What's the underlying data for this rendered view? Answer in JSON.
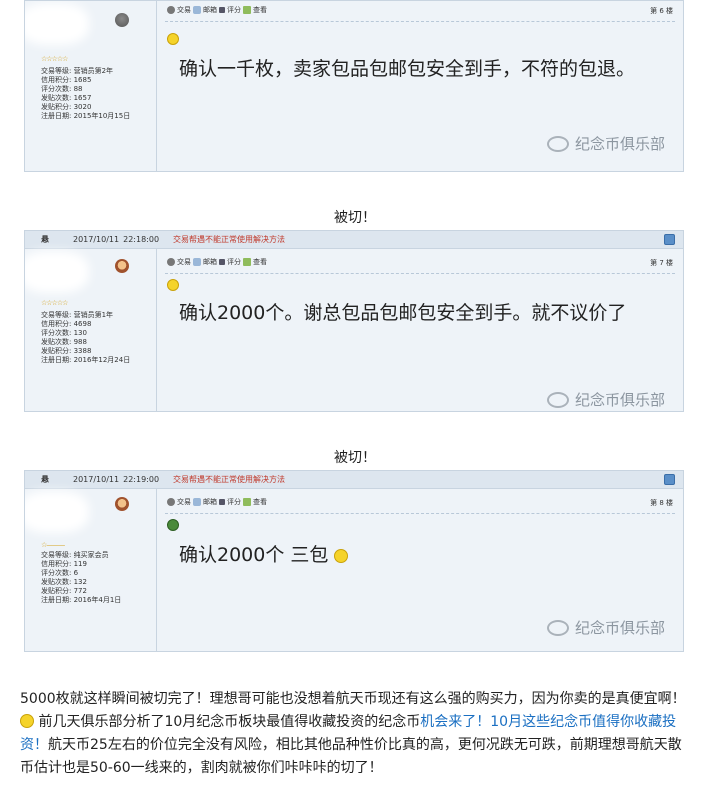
{
  "posts": [
    {
      "header": null,
      "user": {
        "stars": "☆☆☆☆☆",
        "info": [
          "交易等级: 营销员第2年",
          "信用积分: 1685",
          "评分次数: 88",
          "发贴次数: 1657",
          "发贴积分: 3020",
          "注册日期: 2015年10月15日"
        ]
      },
      "toolbar": {
        "trade": "交易",
        "mail": "邮箱",
        "rate": "评分",
        "view": "查看"
      },
      "floor": "第 6 楼",
      "text": "确认一千枚，卖家包品包邮包安全到手，不符的包退。",
      "watermark": "纪念币俱乐部"
    },
    {
      "header": {
        "author": "悬",
        "date": "2017/10/11",
        "time": "22:18:00",
        "notice": "交易帮遇不能正常使用解决方法"
      },
      "user": {
        "stars": "☆☆☆☆☆",
        "info": [
          "交易等级: 营销员第1年",
          "信用积分: 4698",
          "评分次数: 130",
          "发贴次数: 988",
          "发贴积分: 3388",
          "注册日期: 2016年12月24日"
        ]
      },
      "toolbar": {
        "trade": "交易",
        "mail": "邮箱",
        "rate": "评分",
        "view": "查看"
      },
      "floor": "第 7 楼",
      "text": "确认2000个。谢总包品包邮包安全到手。就不议价了",
      "watermark": "纪念币俱乐部"
    },
    {
      "header": {
        "author": "悬",
        "date": "2017/10/11",
        "time": "22:19:00",
        "notice": "交易帮遇不能正常使用解决方法"
      },
      "user": {
        "stars": "☆———",
        "info": [
          "交易等级: 纯买家会员",
          "信用积分: 119",
          "评分次数: 6",
          "发贴次数: 132",
          "发贴积分: 772",
          "注册日期: 2016年4月1日"
        ]
      },
      "toolbar": {
        "trade": "交易",
        "mail": "邮箱",
        "rate": "评分",
        "view": "查看"
      },
      "floor": "第 8 楼",
      "text": "确认2000个  三包",
      "watermark": "纪念币俱乐部"
    }
  ],
  "cut_labels": [
    "被切！",
    "被切！"
  ],
  "paragraph": {
    "part1": "5000枚就这样瞬间被切完了！理想哥可能也没想着航天币现还有这么强的购买力，因为你卖的是真便宜啊！",
    "part2": " 前几天俱乐部分析了10月纪念币板块最值得收藏投资的纪念币",
    "link": "机会来了！10月这些纪念币值得你收藏投资！",
    "part3": "航天币25左右的价位完全没有风险，相比其他品种性价比真的高，更何况跌无可跌，前期理想哥航天散币估计也是50-60一线来的，割肉就被你们咔咔咔的切了！"
  }
}
